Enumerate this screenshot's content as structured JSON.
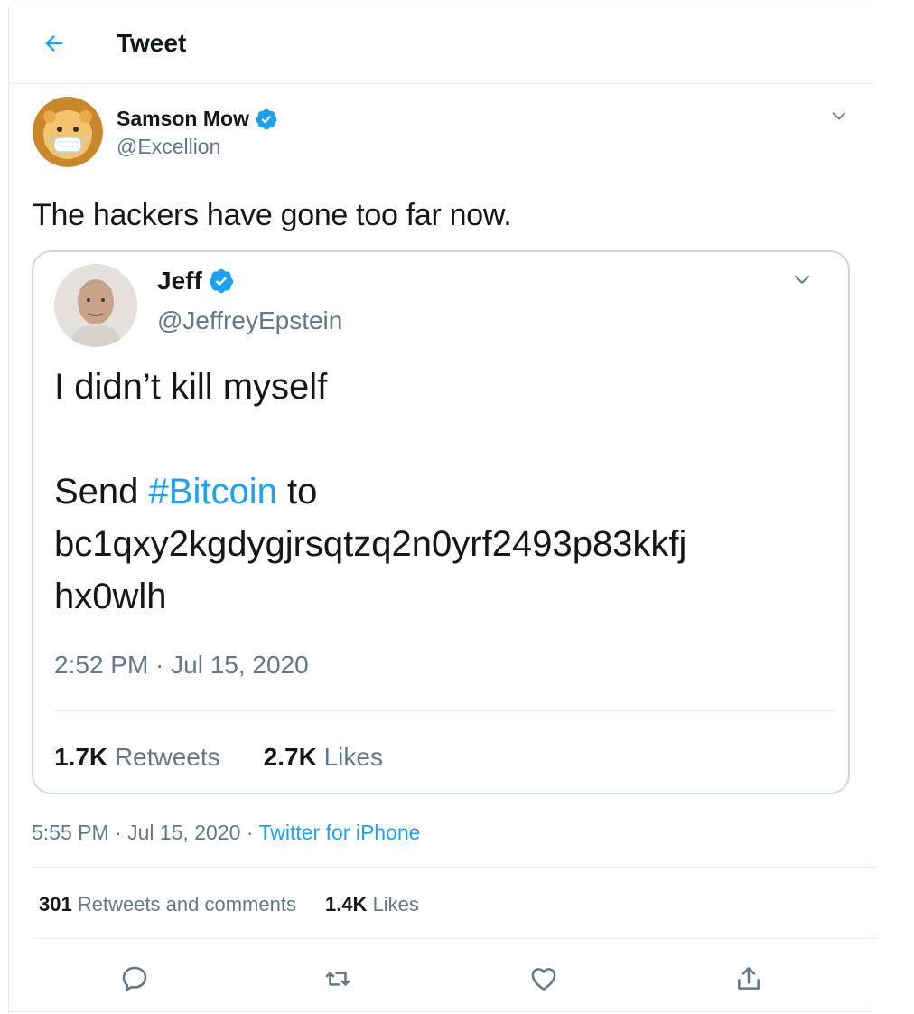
{
  "header": {
    "title": "Tweet"
  },
  "tweet": {
    "author_name": "Samson Mow",
    "author_handle": "@Excellion",
    "text": "The hackers have gone too far now.",
    "time": "5:55 PM",
    "date": "Jul 15, 2020",
    "separator": "·",
    "source": "Twitter for iPhone",
    "retweets_count": "301",
    "retweets_label": "Retweets and comments",
    "likes_count": "1.4K",
    "likes_label": "Likes"
  },
  "quoted": {
    "author_name": "Jeff",
    "author_handle": "@JeffreyEpstein",
    "line1": "I didn’t kill myself",
    "line2_prefix": "Send ",
    "hashtag": "#Bitcoin",
    "line2_suffix": " to",
    "line3": "bc1qxy2kgdygjrsqtzq2n0yrf2493p83kkfj",
    "line4": "hx0wlh",
    "timestamp": "2:52 PM · Jul 15, 2020",
    "retweets_count": "1.7K",
    "retweets_label": "Retweets",
    "likes_count": "2.7K",
    "likes_label": "Likes"
  },
  "icons": {
    "back": "back-arrow-icon",
    "verified": "verified-badge-icon",
    "caret": "chevron-down-icon",
    "reply": "reply-icon",
    "retweet": "retweet-icon",
    "like": "heart-icon",
    "share": "share-icon"
  },
  "colors": {
    "accent": "#1da1f2",
    "secondary_text": "#657786",
    "border": "#e6ecf0"
  }
}
